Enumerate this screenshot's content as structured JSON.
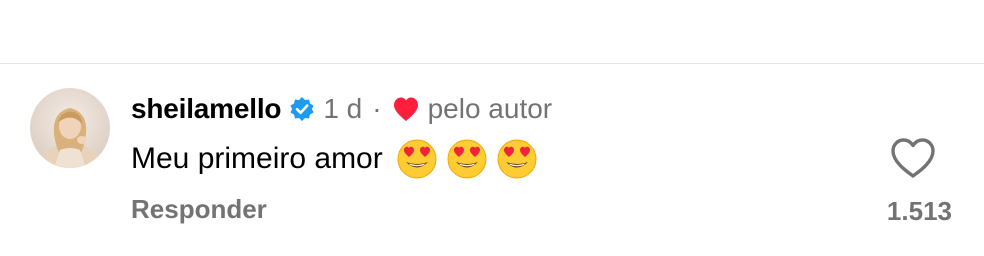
{
  "comment": {
    "username": "sheilamello",
    "verified_icon": "verified-badge-icon",
    "time": "1 d",
    "separator": "·",
    "liked_by_author_icon": "heart-filled-icon",
    "liked_by_author_label": "pelo autor",
    "text": "Meu primeiro amor",
    "emojis": [
      "heart-eyes-emoji-icon",
      "heart-eyes-emoji-icon",
      "heart-eyes-emoji-icon"
    ],
    "reply_label": "Responder",
    "like_icon": "heart-outline-icon",
    "like_count": "1.513"
  },
  "colors": {
    "verified_blue": "#1d9bf0",
    "author_heart_red": "#ff1f3d",
    "secondary_text": "#737373",
    "divider": "#e6e6e6"
  }
}
